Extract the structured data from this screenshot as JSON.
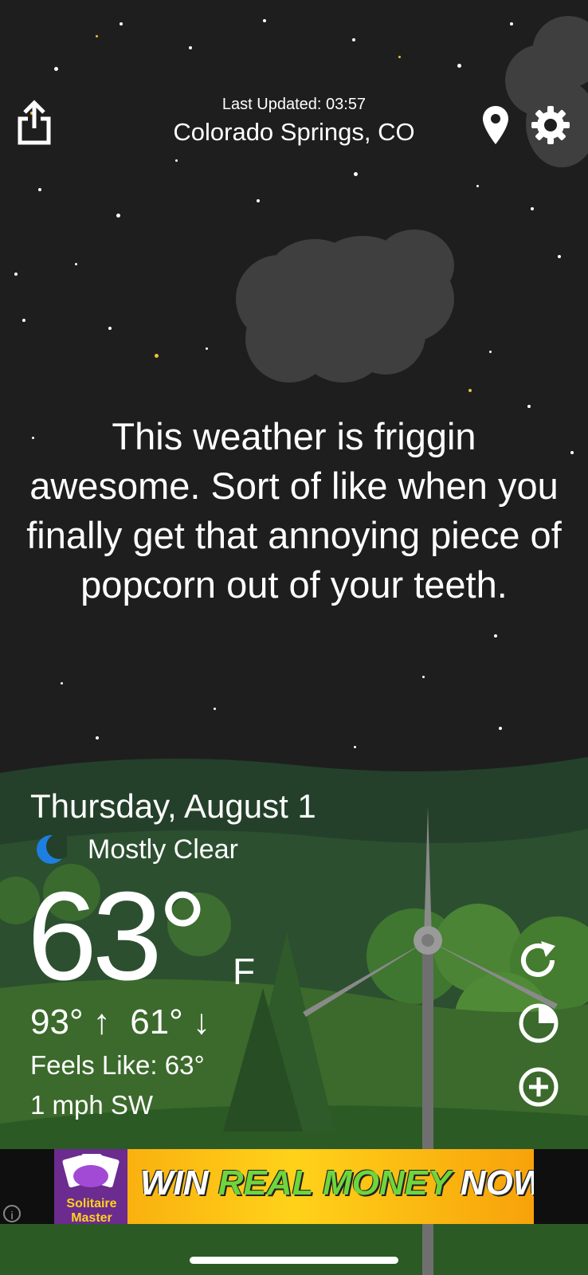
{
  "header": {
    "last_updated": "Last Updated: 03:57",
    "location": "Colorado Springs, CO",
    "share_icon": "share-icon",
    "location_icon": "map-pin-icon",
    "settings_icon": "gear-icon"
  },
  "quote": "This weather is friggin awesome. Sort of like when you finally get that annoying piece of popcorn out of your teeth.",
  "weather": {
    "date": "Thursday, August 1",
    "condition_icon": "crescent-moon-icon",
    "condition": "Mostly Clear",
    "temperature": "63°",
    "unit": "F",
    "high_low": "93° ↑  61° ↓",
    "feels_like": "Feels Like: 63°",
    "wind": "1 mph SW"
  },
  "side_actions": [
    "refresh-icon",
    "radar-icon",
    "add-icon"
  ],
  "ad": {
    "logo_text": "Solitaire Master",
    "headline_part1": "WIN ",
    "headline_part2": "REAL MONEY",
    "headline_part3": " NOW!",
    "info_icon": "info-icon"
  },
  "colors": {
    "sky": "#1e1e1f",
    "hills": "#2e5a32",
    "moon": "#1d7fe0",
    "ad_bg": "#f7a20a"
  }
}
